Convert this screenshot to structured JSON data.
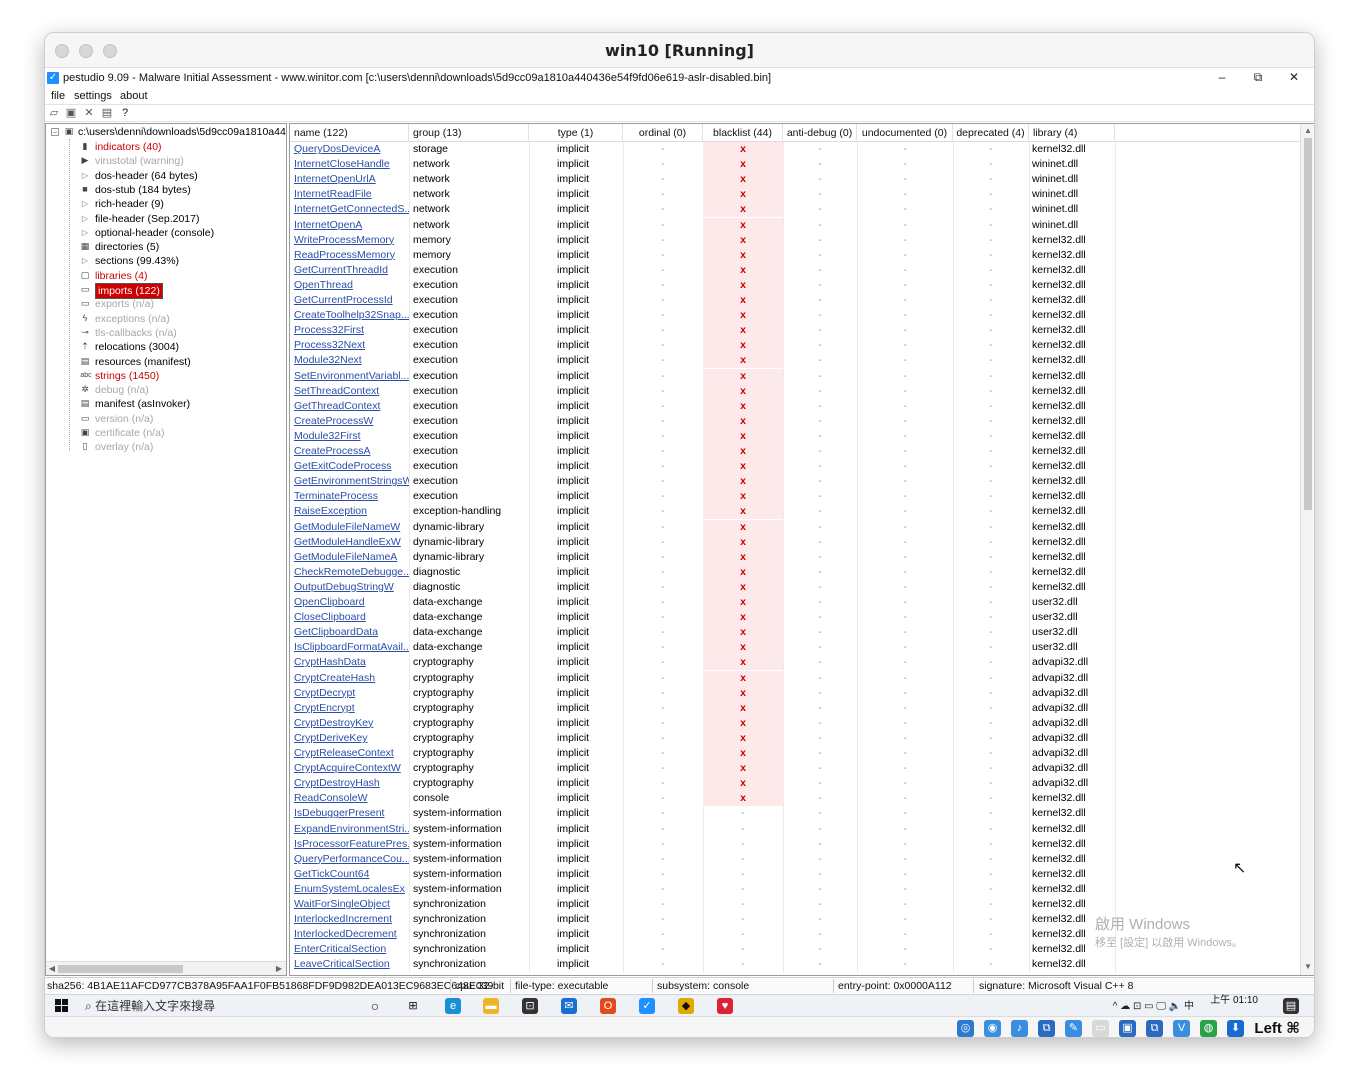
{
  "vm": {
    "title": "win10 [Running]"
  },
  "app": {
    "title": "pestudio 9.09 - Malware Initial Assessment - www.winitor.com [c:\\users\\denni\\downloads\\5d9cc09a1810a440436e54f9fd06e619-aslr-disabled.bin]",
    "minimize": "–",
    "restore": "⧉",
    "close": "✕"
  },
  "menu": {
    "file": "file",
    "settings": "settings",
    "about": "about"
  },
  "tree": {
    "root": "c:\\users\\denni\\downloads\\5d9cc09a1810a44",
    "items": [
      {
        "label": "indicators (40)",
        "style": "red",
        "icon": "indicators-icon",
        "expander": false
      },
      {
        "label": "virustotal (warning)",
        "style": "grey",
        "icon": "virustotal-icon",
        "expander": false
      },
      {
        "label": "dos-header (64 bytes)",
        "style": "norm",
        "icon": "header-icon",
        "expander": true
      },
      {
        "label": "dos-stub (184 bytes)",
        "style": "norm",
        "icon": "dos-stub-icon",
        "expander": false
      },
      {
        "label": "rich-header (9)",
        "style": "norm",
        "icon": "header-icon",
        "expander": true
      },
      {
        "label": "file-header (Sep.2017)",
        "style": "norm",
        "icon": "header-icon",
        "expander": true
      },
      {
        "label": "optional-header (console)",
        "style": "norm",
        "icon": "header-icon",
        "expander": true
      },
      {
        "label": "directories (5)",
        "style": "norm",
        "icon": "directories-icon",
        "expander": false
      },
      {
        "label": "sections (99.43%)",
        "style": "norm",
        "icon": "sections-icon",
        "expander": true
      },
      {
        "label": "libraries (4)",
        "style": "red",
        "icon": "libraries-icon",
        "expander": false
      },
      {
        "label": "imports (122)",
        "style": "selected",
        "icon": "imports-icon",
        "expander": false
      },
      {
        "label": "exports (n/a)",
        "style": "grey",
        "icon": "exports-icon",
        "expander": false
      },
      {
        "label": "exceptions (n/a)",
        "style": "grey",
        "icon": "exceptions-icon",
        "expander": false
      },
      {
        "label": "tls-callbacks (n/a)",
        "style": "grey",
        "icon": "tls-icon",
        "expander": false
      },
      {
        "label": "relocations (3004)",
        "style": "norm",
        "icon": "relocations-icon",
        "expander": false
      },
      {
        "label": "resources (manifest)",
        "style": "norm",
        "icon": "resources-icon",
        "expander": false
      },
      {
        "label": "strings (1450)",
        "style": "red",
        "icon": "strings-icon",
        "expander": false
      },
      {
        "label": "debug (n/a)",
        "style": "grey",
        "icon": "debug-icon",
        "expander": false
      },
      {
        "label": "manifest (asInvoker)",
        "style": "norm",
        "icon": "manifest-icon",
        "expander": false
      },
      {
        "label": "version (n/a)",
        "style": "grey",
        "icon": "version-icon",
        "expander": false
      },
      {
        "label": "certificate (n/a)",
        "style": "grey",
        "icon": "certificate-icon",
        "expander": false
      },
      {
        "label": "overlay (n/a)",
        "style": "grey",
        "icon": "overlay-icon",
        "expander": false
      }
    ]
  },
  "table": {
    "headers": [
      "name (122)",
      "group (13)",
      "type (1)",
      "ordinal (0)",
      "blacklist (44)",
      "anti-debug (0)",
      "undocumented (0)",
      "deprecated (4)",
      "library (4)"
    ],
    "rows": [
      [
        "QueryDosDeviceA",
        "storage",
        "implicit",
        "-",
        "x",
        "-",
        "-",
        "-",
        "kernel32.dll"
      ],
      [
        "InternetCloseHandle",
        "network",
        "implicit",
        "-",
        "x",
        "-",
        "-",
        "-",
        "wininet.dll"
      ],
      [
        "InternetOpenUrlA",
        "network",
        "implicit",
        "-",
        "x",
        "-",
        "-",
        "-",
        "wininet.dll"
      ],
      [
        "InternetReadFile",
        "network",
        "implicit",
        "-",
        "x",
        "-",
        "-",
        "-",
        "wininet.dll"
      ],
      [
        "InternetGetConnectedS...",
        "network",
        "implicit",
        "-",
        "x",
        "-",
        "-",
        "-",
        "wininet.dll"
      ],
      [
        "InternetOpenA",
        "network",
        "implicit",
        "-",
        "x",
        "-",
        "-",
        "-",
        "wininet.dll"
      ],
      [
        "WriteProcessMemory",
        "memory",
        "implicit",
        "-",
        "x",
        "-",
        "-",
        "-",
        "kernel32.dll"
      ],
      [
        "ReadProcessMemory",
        "memory",
        "implicit",
        "-",
        "x",
        "-",
        "-",
        "-",
        "kernel32.dll"
      ],
      [
        "GetCurrentThreadId",
        "execution",
        "implicit",
        "-",
        "x",
        "-",
        "-",
        "-",
        "kernel32.dll"
      ],
      [
        "OpenThread",
        "execution",
        "implicit",
        "-",
        "x",
        "-",
        "-",
        "-",
        "kernel32.dll"
      ],
      [
        "GetCurrentProcessId",
        "execution",
        "implicit",
        "-",
        "x",
        "-",
        "-",
        "-",
        "kernel32.dll"
      ],
      [
        "CreateToolhelp32Snap...",
        "execution",
        "implicit",
        "-",
        "x",
        "-",
        "-",
        "-",
        "kernel32.dll"
      ],
      [
        "Process32First",
        "execution",
        "implicit",
        "-",
        "x",
        "-",
        "-",
        "-",
        "kernel32.dll"
      ],
      [
        "Process32Next",
        "execution",
        "implicit",
        "-",
        "x",
        "-",
        "-",
        "-",
        "kernel32.dll"
      ],
      [
        "Module32Next",
        "execution",
        "implicit",
        "-",
        "x",
        "-",
        "-",
        "-",
        "kernel32.dll"
      ],
      [
        "SetEnvironmentVariabl...",
        "execution",
        "implicit",
        "-",
        "x",
        "-",
        "-",
        "-",
        "kernel32.dll"
      ],
      [
        "SetThreadContext",
        "execution",
        "implicit",
        "-",
        "x",
        "-",
        "-",
        "-",
        "kernel32.dll"
      ],
      [
        "GetThreadContext",
        "execution",
        "implicit",
        "-",
        "x",
        "-",
        "-",
        "-",
        "kernel32.dll"
      ],
      [
        "CreateProcessW",
        "execution",
        "implicit",
        "-",
        "x",
        "-",
        "-",
        "-",
        "kernel32.dll"
      ],
      [
        "Module32First",
        "execution",
        "implicit",
        "-",
        "x",
        "-",
        "-",
        "-",
        "kernel32.dll"
      ],
      [
        "CreateProcessA",
        "execution",
        "implicit",
        "-",
        "x",
        "-",
        "-",
        "-",
        "kernel32.dll"
      ],
      [
        "GetExitCodeProcess",
        "execution",
        "implicit",
        "-",
        "x",
        "-",
        "-",
        "-",
        "kernel32.dll"
      ],
      [
        "GetEnvironmentStringsW",
        "execution",
        "implicit",
        "-",
        "x",
        "-",
        "-",
        "-",
        "kernel32.dll"
      ],
      [
        "TerminateProcess",
        "execution",
        "implicit",
        "-",
        "x",
        "-",
        "-",
        "-",
        "kernel32.dll"
      ],
      [
        "RaiseException",
        "exception-handling",
        "implicit",
        "-",
        "x",
        "-",
        "-",
        "-",
        "kernel32.dll"
      ],
      [
        "GetModuleFileNameW",
        "dynamic-library",
        "implicit",
        "-",
        "x",
        "-",
        "-",
        "-",
        "kernel32.dll"
      ],
      [
        "GetModuleHandleExW",
        "dynamic-library",
        "implicit",
        "-",
        "x",
        "-",
        "-",
        "-",
        "kernel32.dll"
      ],
      [
        "GetModuleFileNameA",
        "dynamic-library",
        "implicit",
        "-",
        "x",
        "-",
        "-",
        "-",
        "kernel32.dll"
      ],
      [
        "CheckRemoteDebugge...",
        "diagnostic",
        "implicit",
        "-",
        "x",
        "-",
        "-",
        "-",
        "kernel32.dll"
      ],
      [
        "OutputDebugStringW",
        "diagnostic",
        "implicit",
        "-",
        "x",
        "-",
        "-",
        "-",
        "kernel32.dll"
      ],
      [
        "OpenClipboard",
        "data-exchange",
        "implicit",
        "-",
        "x",
        "-",
        "-",
        "-",
        "user32.dll"
      ],
      [
        "CloseClipboard",
        "data-exchange",
        "implicit",
        "-",
        "x",
        "-",
        "-",
        "-",
        "user32.dll"
      ],
      [
        "GetClipboardData",
        "data-exchange",
        "implicit",
        "-",
        "x",
        "-",
        "-",
        "-",
        "user32.dll"
      ],
      [
        "IsClipboardFormatAvail...",
        "data-exchange",
        "implicit",
        "-",
        "x",
        "-",
        "-",
        "-",
        "user32.dll"
      ],
      [
        "CryptHashData",
        "cryptography",
        "implicit",
        "-",
        "x",
        "-",
        "-",
        "-",
        "advapi32.dll"
      ],
      [
        "CryptCreateHash",
        "cryptography",
        "implicit",
        "-",
        "x",
        "-",
        "-",
        "-",
        "advapi32.dll"
      ],
      [
        "CryptDecrypt",
        "cryptography",
        "implicit",
        "-",
        "x",
        "-",
        "-",
        "-",
        "advapi32.dll"
      ],
      [
        "CryptEncrypt",
        "cryptography",
        "implicit",
        "-",
        "x",
        "-",
        "-",
        "-",
        "advapi32.dll"
      ],
      [
        "CryptDestroyKey",
        "cryptography",
        "implicit",
        "-",
        "x",
        "-",
        "-",
        "-",
        "advapi32.dll"
      ],
      [
        "CryptDeriveKey",
        "cryptography",
        "implicit",
        "-",
        "x",
        "-",
        "-",
        "-",
        "advapi32.dll"
      ],
      [
        "CryptReleaseContext",
        "cryptography",
        "implicit",
        "-",
        "x",
        "-",
        "-",
        "-",
        "advapi32.dll"
      ],
      [
        "CryptAcquireContextW",
        "cryptography",
        "implicit",
        "-",
        "x",
        "-",
        "-",
        "-",
        "advapi32.dll"
      ],
      [
        "CryptDestroyHash",
        "cryptography",
        "implicit",
        "-",
        "x",
        "-",
        "-",
        "-",
        "advapi32.dll"
      ],
      [
        "ReadConsoleW",
        "console",
        "implicit",
        "-",
        "x",
        "-",
        "-",
        "-",
        "kernel32.dll"
      ],
      [
        "IsDebuggerPresent",
        "system-information",
        "implicit",
        "-",
        "-",
        "-",
        "-",
        "-",
        "kernel32.dll"
      ],
      [
        "ExpandEnvironmentStri...",
        "system-information",
        "implicit",
        "-",
        "-",
        "-",
        "-",
        "-",
        "kernel32.dll"
      ],
      [
        "IsProcessorFeaturePres...",
        "system-information",
        "implicit",
        "-",
        "-",
        "-",
        "-",
        "-",
        "kernel32.dll"
      ],
      [
        "QueryPerformanceCou...",
        "system-information",
        "implicit",
        "-",
        "-",
        "-",
        "-",
        "-",
        "kernel32.dll"
      ],
      [
        "GetTickCount64",
        "system-information",
        "implicit",
        "-",
        "-",
        "-",
        "-",
        "-",
        "kernel32.dll"
      ],
      [
        "EnumSystemLocalesEx",
        "system-information",
        "implicit",
        "-",
        "-",
        "-",
        "-",
        "-",
        "kernel32.dll"
      ],
      [
        "WaitForSingleObject",
        "synchronization",
        "implicit",
        "-",
        "-",
        "-",
        "-",
        "-",
        "kernel32.dll"
      ],
      [
        "InterlockedIncrement",
        "synchronization",
        "implicit",
        "-",
        "-",
        "-",
        "-",
        "-",
        "kernel32.dll"
      ],
      [
        "InterlockedDecrement",
        "synchronization",
        "implicit",
        "-",
        "-",
        "-",
        "-",
        "-",
        "kernel32.dll"
      ],
      [
        "EnterCriticalSection",
        "synchronization",
        "implicit",
        "-",
        "-",
        "-",
        "-",
        "-",
        "kernel32.dll"
      ],
      [
        "LeaveCriticalSection",
        "synchronization",
        "implicit",
        "-",
        "-",
        "-",
        "-",
        "-",
        "kernel32.dll"
      ]
    ]
  },
  "watermark": {
    "line1": "啟用 Windows",
    "line2": "移至 [設定] 以啟用 Windows。"
  },
  "status": {
    "sha256": "sha256: 4B1AE11AFCD977CB378A95FAA1F0FB51868FDF9D982DEA013EC9683EC648E039",
    "cpu": "cpu: 32-bit",
    "filetype": "file-type: executable",
    "subsystem": "subsystem: console",
    "entry": "entry-point: 0x0000A112",
    "signature": "signature: Microsoft Visual C++ 8"
  },
  "taskbar": {
    "search_placeholder": "在這裡輸入文字來搜尋",
    "clock_time": "上午 01:10",
    "tray": "^ ☁ ⊡ ▭ 🖵 🔈 中"
  },
  "vbox": {
    "host_key": "Left ⌘"
  },
  "colors": {
    "selected": "#cc0000",
    "blacklist_bg": "#fde8ea",
    "link": "#2b4fa8"
  }
}
